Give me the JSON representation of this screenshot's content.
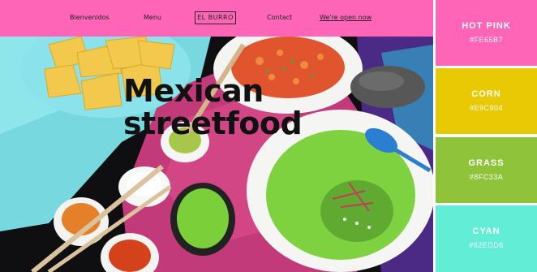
{
  "navbar": {
    "links": [
      "Bienvenidos",
      "Menu",
      "Contact",
      "We're open now"
    ],
    "logo": "EL BURRO",
    "background": "#FE65B7"
  },
  "hero": {
    "title_line1": "Mexican",
    "title_line2": "streetfood"
  },
  "palette": {
    "swatches": [
      {
        "name": "HOT PINK",
        "hex": "#FE65B7"
      },
      {
        "name": "CORN",
        "hex": "#E9C904"
      },
      {
        "name": "GRASS",
        "hex": "#8FC33A"
      },
      {
        "name": "CYAN",
        "hex": "#62EDD6"
      }
    ]
  }
}
